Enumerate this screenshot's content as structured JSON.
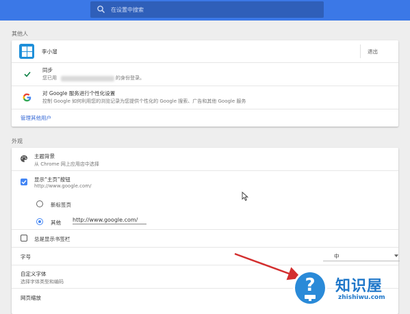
{
  "search": {
    "placeholder": "在设置中搜索"
  },
  "people": {
    "section_title": "其他人",
    "user_name": "李小溜",
    "signout_label": "退出",
    "sync_title": "同步",
    "sync_prefix": "您已用",
    "sync_suffix": "的身份登录。",
    "personalize_title": "对 Google 服务进行个性化设置",
    "personalize_desc": "控制 Google 如何利用您的浏览记录为您提供个性化的 Google 搜索、广告和其他 Google 服务",
    "manage_link": "管理其他用户"
  },
  "appearance": {
    "section_title": "外观",
    "theme_title": "主题背景",
    "theme_desc": "从 Chrome 网上应用店中选择",
    "home_title": "显示“主页”按钮",
    "home_url": "http://www.google.com/",
    "home_checked": true,
    "radio_newtab": "新标签页",
    "radio_other": "其他",
    "other_url_value": "http://www.google.com/",
    "bookmarks_label": "总是显示书签栏",
    "bookmarks_checked": false,
    "fontsize_label": "字号",
    "fontsize_value": "中",
    "customfont_title": "自定义字体",
    "customfont_desc": "选择字体类型和编码",
    "zoom_label": "网页缩放"
  },
  "watermark": {
    "name": "知识屋",
    "domain": "zhishiwu.com"
  },
  "colors": {
    "topbar": "#3b78e7",
    "accent": "#4285f4",
    "link": "#3367d6"
  }
}
